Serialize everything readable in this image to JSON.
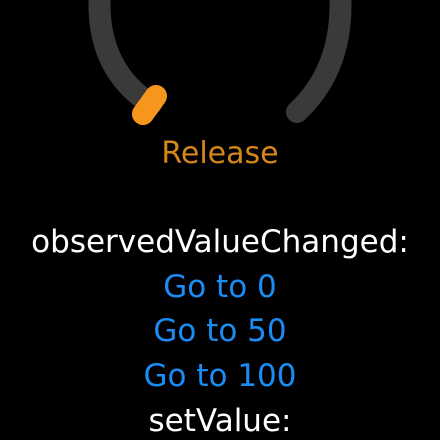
{
  "knob": {
    "value": 0,
    "track_color": "#3A3A3A",
    "thumb_color": "#F7961D"
  },
  "status_label": "Release",
  "observed_header": "observedValueChanged:",
  "buttons": [
    {
      "label": "Go to 0"
    },
    {
      "label": "Go to 50"
    },
    {
      "label": "Go to 100"
    }
  ],
  "set_value_header": "setValue:",
  "colors": {
    "accent": "#D5871A",
    "link": "#1A8CF4",
    "text": "#FFFFFF",
    "background": "#000000"
  }
}
